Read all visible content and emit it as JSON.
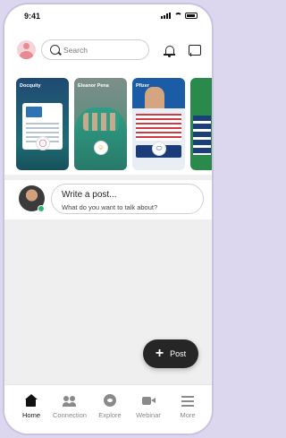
{
  "status_bar": {
    "time": "9:41"
  },
  "search": {
    "placeholder": "Search"
  },
  "stories": [
    {
      "name": "Docquity"
    },
    {
      "name": "Eleanor Pena"
    },
    {
      "name": "Pfizer"
    }
  ],
  "composer": {
    "title": "Write a post...",
    "subtitle": "What do you want to talk about?"
  },
  "fab": {
    "icon": "plus-icon",
    "label": "Post"
  },
  "tabbar": {
    "items": [
      {
        "label": "Home",
        "icon": "home-icon",
        "active": true
      },
      {
        "label": "Connection",
        "icon": "people-icon",
        "active": false
      },
      {
        "label": "Explore",
        "icon": "explore-icon",
        "active": false
      },
      {
        "label": "Webinar",
        "icon": "video-icon",
        "active": false
      },
      {
        "label": "More",
        "icon": "menu-icon",
        "active": false
      }
    ]
  }
}
